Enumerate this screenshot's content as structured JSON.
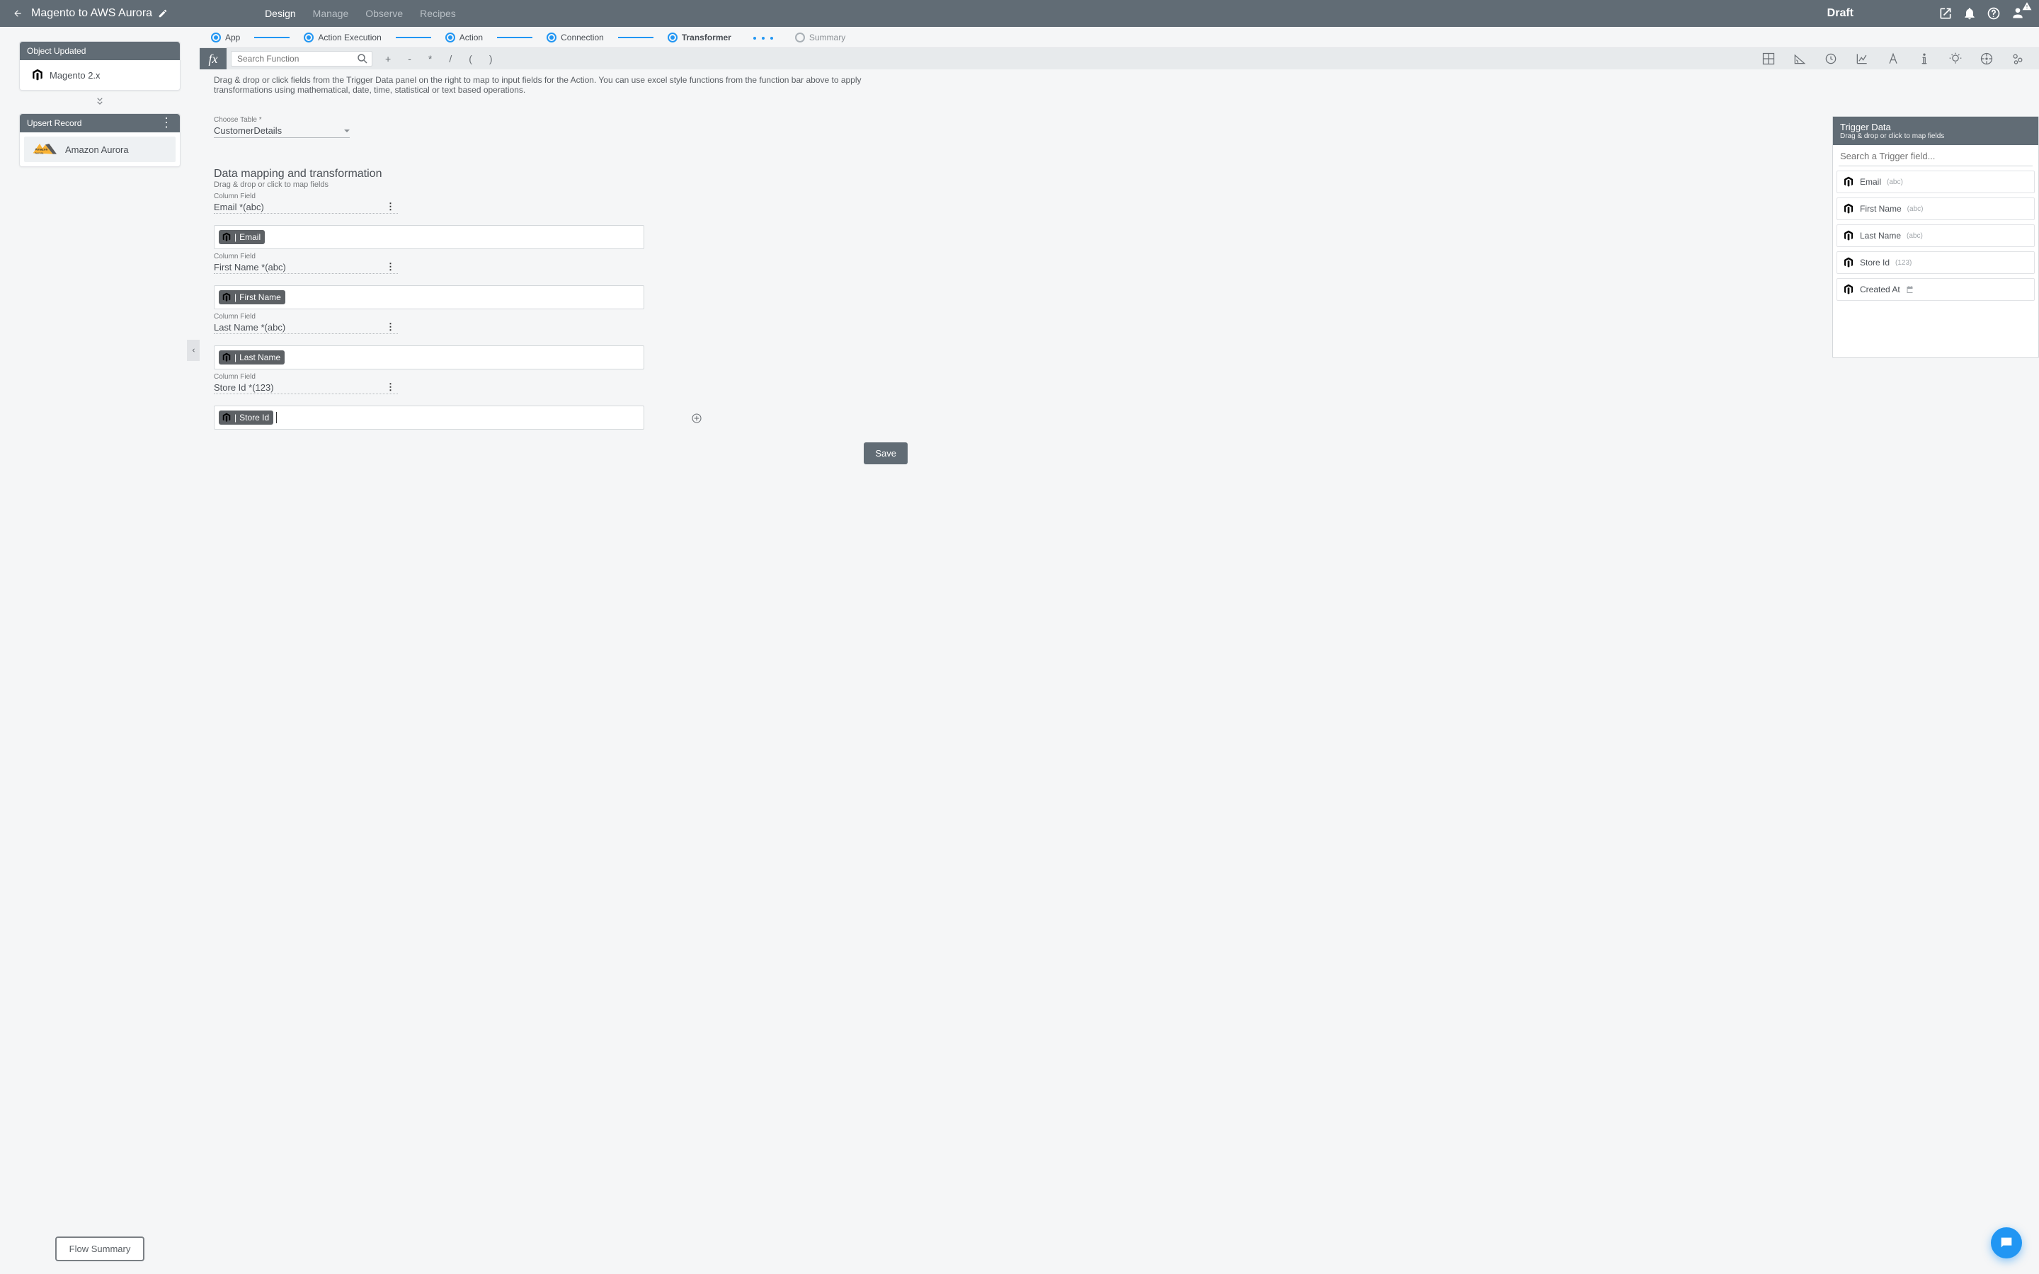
{
  "header": {
    "title": "Magento to AWS Aurora",
    "status": "Draft",
    "tabs": [
      {
        "label": "Design",
        "active": true
      },
      {
        "label": "Manage"
      },
      {
        "label": "Observe"
      },
      {
        "label": "Recipes"
      }
    ]
  },
  "sidebar": {
    "card1_title": "Object Updated",
    "card1_item": "Magento 2.x",
    "card2_title": "Upsert Record",
    "card2_item": "Amazon Aurora",
    "flow_summary": "Flow Summary"
  },
  "stepper": [
    {
      "label": "App",
      "state": "done"
    },
    {
      "label": "Action Execution",
      "state": "done"
    },
    {
      "label": "Action",
      "state": "done"
    },
    {
      "label": "Connection",
      "state": "done"
    },
    {
      "label": "Transformer",
      "state": "current"
    },
    {
      "label": "Summary",
      "state": "pending"
    }
  ],
  "funcbar": {
    "search_placeholder": "Search Function",
    "ops": [
      "+",
      "-",
      "*",
      "/",
      "(",
      ")"
    ]
  },
  "hint": "Drag & drop or click fields from the Trigger Data panel on the right to map to input fields for the Action. You can use excel style functions from the function bar above to apply transformations using mathematical, date, time, statistical or text based operations.",
  "table_select": {
    "label": "Choose Table *",
    "value": "CustomerDetails"
  },
  "section": {
    "title": "Data mapping and transformation",
    "sub": "Drag & drop or click to map fields"
  },
  "column_field_label": "Column Field",
  "columns": [
    {
      "label": "Email *(abc)",
      "chip": "Email"
    },
    {
      "label": "First Name *(abc)",
      "chip": "First Name"
    },
    {
      "label": "Last Name *(abc)",
      "chip": "Last Name"
    },
    {
      "label": "Store Id *(123)",
      "chip": "Store Id",
      "active": true
    }
  ],
  "save_label": "Save",
  "trigger": {
    "title": "Trigger Data",
    "sub": "Drag & drop or click to map fields",
    "search_placeholder": "Search a Trigger field...",
    "fields": [
      {
        "name": "Email",
        "type": "(abc)"
      },
      {
        "name": "First Name",
        "type": "(abc)"
      },
      {
        "name": "Last Name",
        "type": "(abc)"
      },
      {
        "name": "Store Id",
        "type": "(123)"
      },
      {
        "name": "Created At",
        "type": "date"
      }
    ]
  }
}
